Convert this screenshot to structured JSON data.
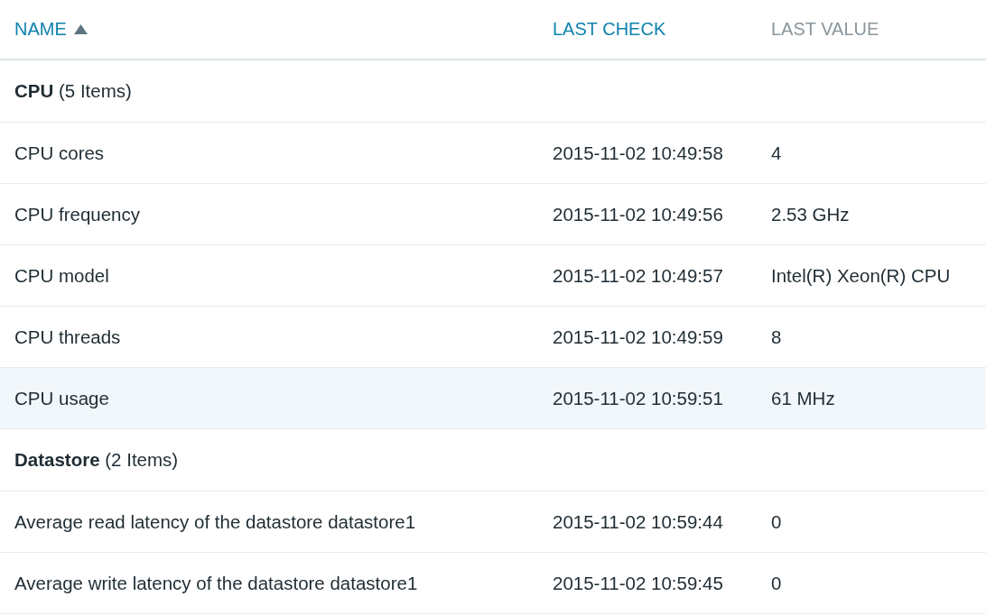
{
  "table": {
    "columns": [
      {
        "label": "NAME",
        "sortable": true,
        "sorted": true
      },
      {
        "label": "LAST CHECK",
        "sortable": true,
        "sorted": false
      },
      {
        "label": "LAST VALUE",
        "sortable": false,
        "sorted": false
      }
    ],
    "groups": [
      {
        "title": "**CPU** (5 Items)",
        "rows": [
          {
            "name": "CPU cores",
            "last_check": "2015-11-02 10:49:58",
            "last_value": "4",
            "selected": false
          },
          {
            "name": "CPU frequency",
            "last_check": "2015-11-02 10:49:56",
            "last_value": "2.53 GHz",
            "selected": false
          },
          {
            "name": "CPU model",
            "last_check": "2015-11-02 10:49:57",
            "last_value": "Intel(R) Xeon(R) CPU",
            "selected": false
          },
          {
            "name": "CPU threads",
            "last_check": "2015-11-02 10:49:59",
            "last_value": "8",
            "selected": false
          },
          {
            "name": "CPU usage",
            "last_check": "2015-11-02 10:59:51",
            "last_value": "61 MHz",
            "selected": true
          }
        ]
      },
      {
        "title": "**Datastore** (2 Items)",
        "rows": [
          {
            "name": "Average read latency of the datastore datastore1",
            "last_check": "2015-11-02 10:59:44",
            "last_value": "0",
            "selected": false
          },
          {
            "name": "Average write latency of the datastore datastore1",
            "last_check": "2015-11-02 10:59:45",
            "last_value": "0",
            "selected": false
          }
        ]
      }
    ]
  }
}
